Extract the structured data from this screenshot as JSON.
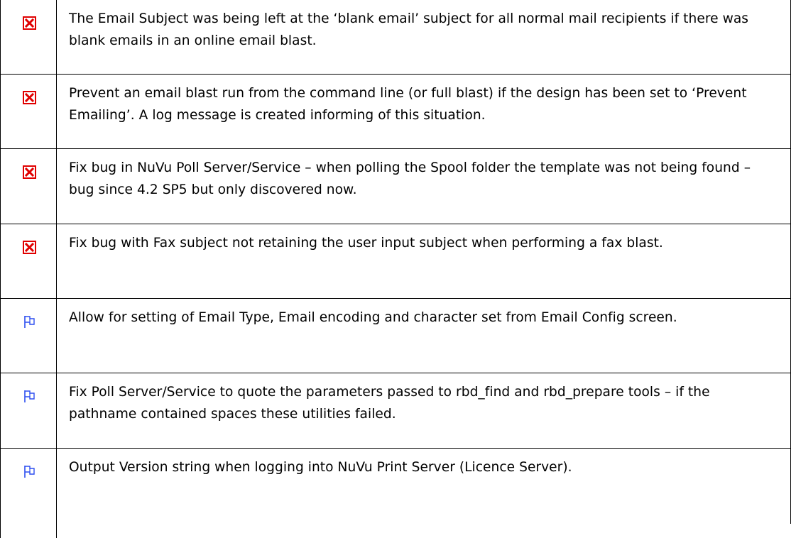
{
  "rows": [
    {
      "type": "bug",
      "icon": "red-x-box-icon",
      "text": "The Email Subject was being left at the ‘blank email’ subject for all normal mail recipients if there was blank emails in an online email blast."
    },
    {
      "type": "bug",
      "icon": "red-x-box-icon",
      "text": "Prevent an email blast run from the command line (or full blast) if the design has been set to ‘Prevent Emailing’. A log message is created informing of this situation."
    },
    {
      "type": "bug",
      "icon": "red-x-box-icon",
      "text": "Fix bug in NuVu Poll Server/Service – when polling the Spool folder the template was not being found – bug since 4.2 SP5 but only discovered now."
    },
    {
      "type": "bug",
      "icon": "red-x-box-icon",
      "text": "Fix bug with Fax subject not retaining the user input subject when performing a fax blast."
    },
    {
      "type": "enhancement",
      "icon": "blue-flag-icon",
      "text": "Allow for setting of Email Type, Email encoding and character set from Email Config screen."
    },
    {
      "type": "enhancement",
      "icon": "blue-flag-icon",
      "text": "Fix Poll Server/Service to quote the parameters passed to rbd_find and rbd_prepare tools – if the pathname contained spaces these utilities failed."
    },
    {
      "type": "enhancement",
      "icon": "blue-flag-icon",
      "text": "Output Version string when logging into NuVu Print Server (Licence Server)."
    }
  ],
  "colors": {
    "bug_icon": "#e00000",
    "enhancement_icon": "#2d4ef0",
    "border": "#000000"
  }
}
